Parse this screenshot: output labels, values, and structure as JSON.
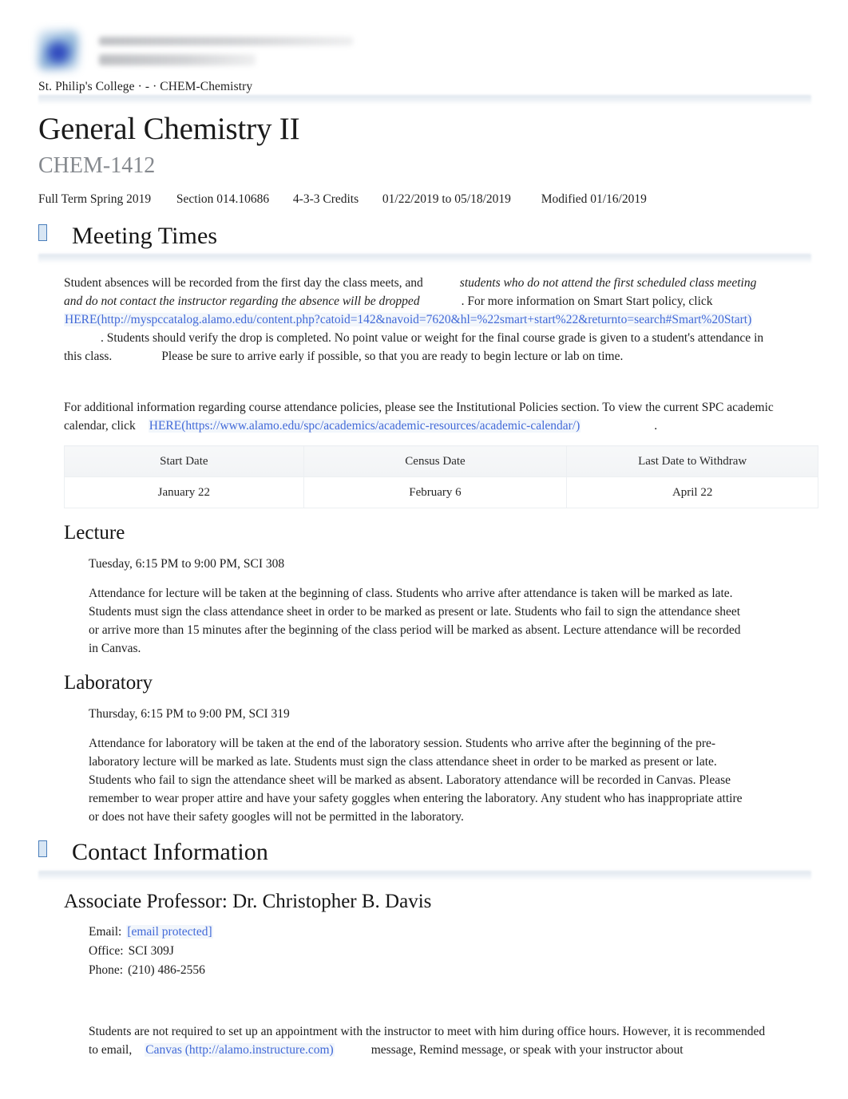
{
  "masthead": {
    "logo_alt": "St. Philip's College logo",
    "breadcrumb": "St. Philip's College · - · CHEM-Chemistry"
  },
  "header": {
    "course_title": "General Chemistry II",
    "course_code": "CHEM-1412",
    "meta": {
      "term": "Full Term Spring 2019",
      "section": "Section 014.10686",
      "credits": "4-3-3 Credits",
      "dates": "01/22/2019 to 05/18/2019",
      "modified": "Modified 01/16/2019"
    }
  },
  "sections": {
    "meeting_times": {
      "title": "Meeting Times",
      "paragraph1": {
        "part1": "Student absences will be recorded from the first day the class meets, and",
        "italic1": "students who do not attend the first scheduled class meeting and do not contact the instructor regarding the absence will be dropped",
        "part2": ". For more information on Smart Start policy, click",
        "link1_text": "HERE(http://myspccatalog.alamo.edu/content.php?catoid=142&navoid=7620&hl=%22smart+start%22&returnto=search#Smart%20Start)",
        "part3": ". Students should verify the drop is completed. No point value or weight for the final course grade is given to a student's attendance in this class.",
        "part4": "Please be sure to arrive early if possible, so that you are ready to begin lecture or lab on time."
      },
      "paragraph2": {
        "part1": "For additional information regarding course attendance policies, please see the Institutional Policies section. To view the current SPC academic calendar, click",
        "link1_text": "HERE(https://www.alamo.edu/spc/academics/academic-resources/academic-calendar/)",
        "part2": "."
      },
      "table": {
        "headers": [
          "Start Date",
          "Census Date",
          "Last Date to Withdraw"
        ],
        "rows": [
          [
            "January 22",
            "February 6",
            "April 22"
          ]
        ]
      },
      "lecture": {
        "title": "Lecture",
        "time": "Tuesday, 6:15 PM to 9:00 PM, SCI 308",
        "text": "Attendance for lecture will be taken at the beginning of class. Students who arrive after attendance is taken will be marked as late. Students must sign the class attendance sheet in order to be marked as present or late. Students who fail to sign the attendance sheet or arrive more than 15 minutes after the beginning of the class period will be marked as absent. Lecture attendance will be recorded in Canvas."
      },
      "laboratory": {
        "title": "Laboratory",
        "time": "Thursday, 6:15 PM to 9:00 PM, SCI 319",
        "text": "Attendance for laboratory will be taken at the end of the laboratory session. Students who arrive after the beginning of the pre-laboratory lecture will be marked as late. Students must sign the class attendance sheet in order to be marked as present or late. Students who fail to sign the attendance sheet will be marked as absent. Laboratory attendance will be recorded in Canvas. Please remember to wear proper attire and have your safety goggles when entering the laboratory. Any student who has inappropriate attire or does not have their safety googles will not be permitted in the laboratory."
      }
    },
    "contact_information": {
      "title": "Contact Information",
      "professor": "Associate Professor: Dr. Christopher B. Davis",
      "email_label": "Email:",
      "email_value": "[email protected]",
      "office_label": "Office:",
      "office_value": "SCI 309J",
      "phone_label": "Phone:",
      "phone_value": "(210) 486-2556",
      "closing": {
        "part1": "Students are not required to set up an appointment with the instructor to meet with him during office hours. However, it is recommended to email,",
        "link_text": "Canvas  (http://alamo.instructure.com)",
        "part2": "message, Remind message, or speak with your instructor about"
      }
    }
  },
  "colors": {
    "link": "#4169d8",
    "muted_heading": "#85898e",
    "band": "#dee5ed",
    "tofu_border": "#4a7ebb"
  }
}
